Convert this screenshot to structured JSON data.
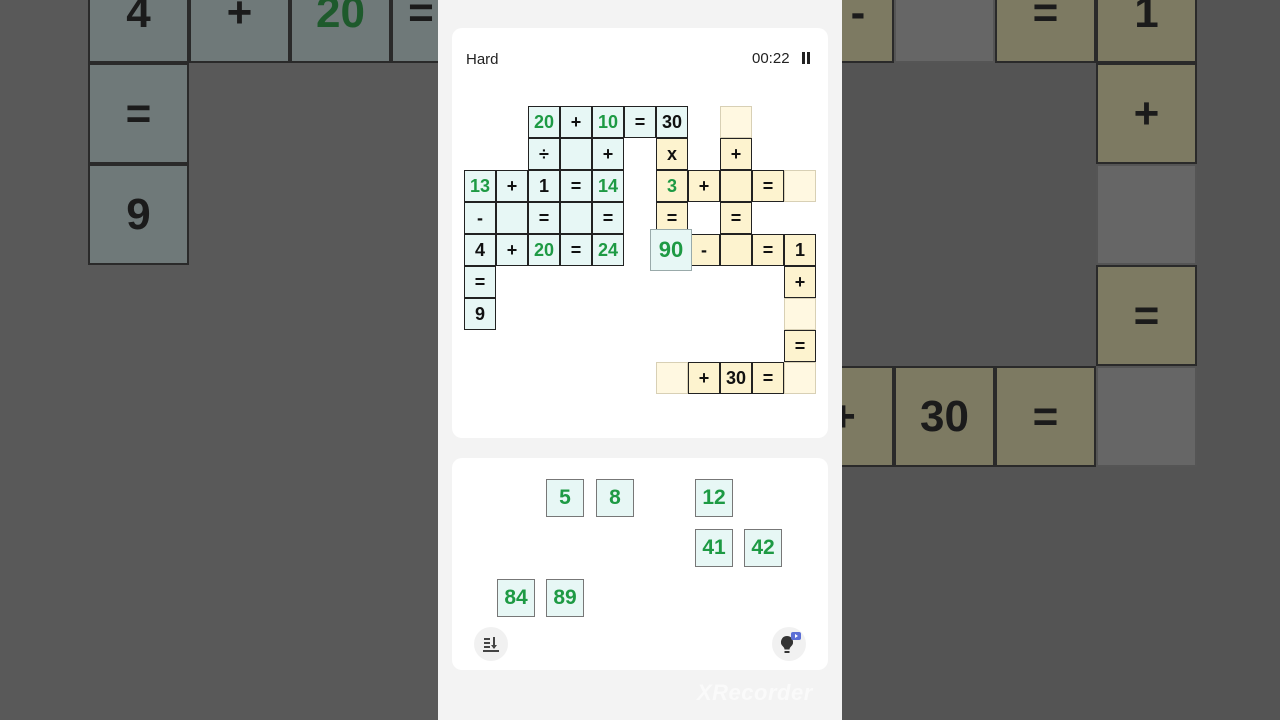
{
  "header": {
    "difficulty": "Hard",
    "timer": "00:22"
  },
  "board": {
    "row1": [
      "20",
      "+",
      "10",
      "=",
      "30"
    ],
    "row2": [
      "÷",
      "+",
      "x",
      "+"
    ],
    "row3": [
      "13",
      "+",
      "1",
      "=",
      "14",
      "3",
      "+",
      "="
    ],
    "row4": [
      "-",
      "=",
      "=",
      "=",
      "="
    ],
    "row5": [
      "4",
      "+",
      "20",
      "=",
      "24",
      "90",
      "-",
      "=",
      "1"
    ],
    "col_left": [
      "=",
      "9"
    ],
    "col_right": [
      "+",
      "="
    ],
    "row_bottom": [
      "+",
      "30",
      "="
    ]
  },
  "tiles": [
    "5",
    "8",
    "12",
    "41",
    "42",
    "84",
    "89"
  ],
  "background": {
    "left": [
      "4",
      "+",
      "20",
      "=",
      "=",
      "9"
    ],
    "right": [
      "-",
      "=",
      "1",
      "+",
      "=",
      "+",
      "30",
      "="
    ]
  },
  "watermark": "XRecorder"
}
